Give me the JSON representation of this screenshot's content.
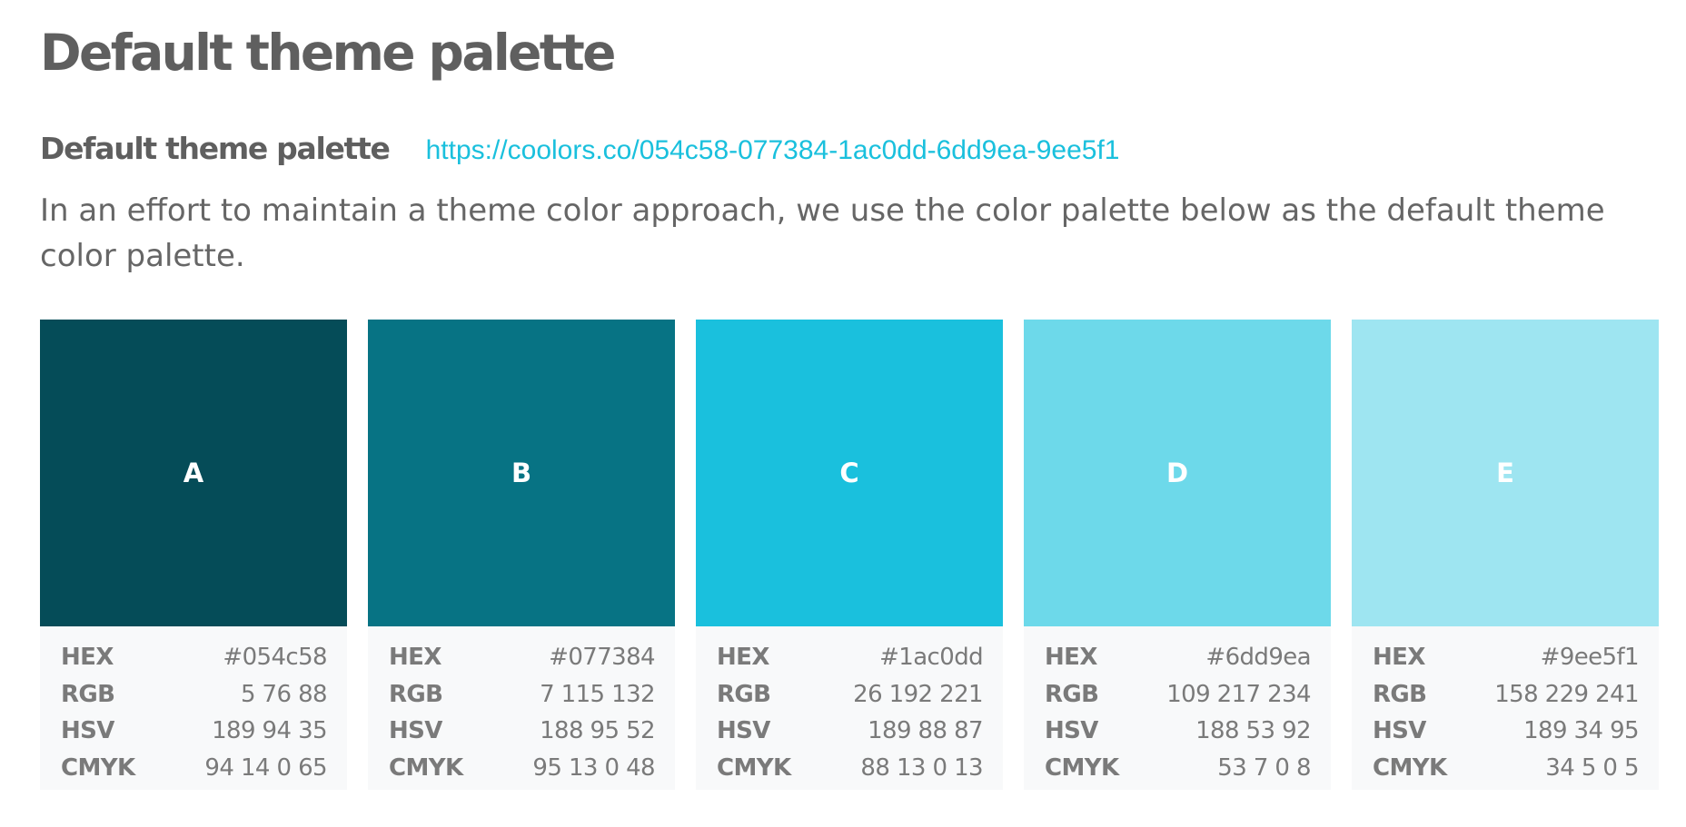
{
  "page": {
    "title": "Default theme palette"
  },
  "section": {
    "title": "Default theme palette",
    "link_text": "https://coolors.co/054c58-077384-1ac0dd-6dd9ea-9ee5f1",
    "intro": "In an effort to maintain a theme color approach, we use the color palette below as the default theme color palette."
  },
  "labels": {
    "hex": "HEX",
    "rgb": "RGB",
    "hsv": "HSV",
    "cmyk": "CMYK"
  },
  "colors": {
    "text": "#666666",
    "link": "#1ac0dd",
    "info_bg": "#f8f9fa"
  },
  "swatches": [
    {
      "letter": "A",
      "color": "#054c58",
      "hex": "#054c58",
      "rgb": "5 76 88",
      "hsv": "189 94 35",
      "cmyk": "94 14 0 65"
    },
    {
      "letter": "B",
      "color": "#077384",
      "hex": "#077384",
      "rgb": "7 115 132",
      "hsv": "188 95 52",
      "cmyk": "95 13 0 48"
    },
    {
      "letter": "C",
      "color": "#1ac0dd",
      "hex": "#1ac0dd",
      "rgb": "26 192 221",
      "hsv": "189 88 87",
      "cmyk": "88 13 0 13"
    },
    {
      "letter": "D",
      "color": "#6dd9ea",
      "hex": "#6dd9ea",
      "rgb": "109 217 234",
      "hsv": "188 53 92",
      "cmyk": "53 7 0 8"
    },
    {
      "letter": "E",
      "color": "#9ee5f1",
      "hex": "#9ee5f1",
      "rgb": "158 229 241",
      "hsv": "189 34 95",
      "cmyk": "34 5 0 5"
    }
  ]
}
